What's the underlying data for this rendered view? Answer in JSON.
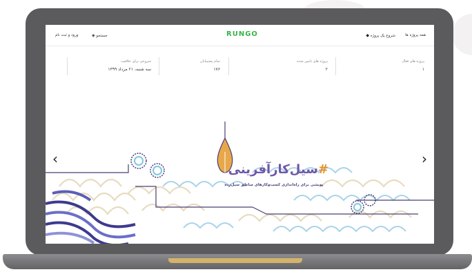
{
  "nav": {
    "all_projects": "همه پروژه ها",
    "start_project": "شروع یک پروژه",
    "logo": "RUNGO",
    "search": "جستجو",
    "login": "ورود و ثبت نام"
  },
  "stats": [
    {
      "label": "پروژه های فعال",
      "value": "۱"
    },
    {
      "label": "پروژه های تامین شده",
      "value": "۲"
    },
    {
      "label": "تمام پشتیبانان",
      "value": "۱۷۶"
    },
    {
      "label": "شروعی برای خلاقیت",
      "value": "سه شنبه، ۲۱ مرداد ۱۳۹۹"
    }
  ],
  "banner": {
    "title": "سیل‌کارآفرینی",
    "hash": "#",
    "subtitle": "پویشی برای راه‌اندازی کسب‌وکارهای مناطق سیل‌زده",
    "prev_arrow": "‹",
    "next_arrow": "›"
  },
  "colors": {
    "brand": "#37b34a",
    "laptop_frame": "#5b5b5e",
    "title_purple": "#6e58a8",
    "accent_orange": "#e2942b"
  },
  "icons": {
    "start_project": "diamond-plus-icon",
    "search": "diamond-plus-icon",
    "prev": "chevron-left-icon",
    "next": "chevron-right-icon"
  }
}
